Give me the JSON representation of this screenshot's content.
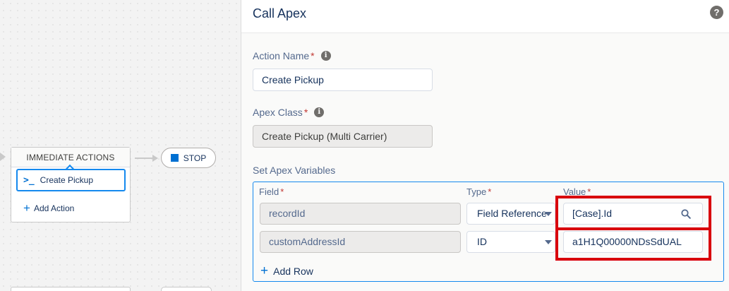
{
  "canvas": {
    "actions_header": "IMMEDIATE ACTIONS",
    "action_item": {
      "icon": ">_",
      "label": "Create Pickup"
    },
    "add_action": "Add Action",
    "stop_label": "STOP"
  },
  "panel": {
    "title": "Call Apex",
    "help_icon": "?",
    "action_name": {
      "label": "Action Name",
      "required": "*",
      "value": "Create Pickup"
    },
    "apex_class": {
      "label": "Apex Class",
      "required": "*",
      "value": "Create Pickup (Multi Carrier)"
    },
    "set_vars": {
      "label": "Set Apex Variables",
      "columns": {
        "field": "Field",
        "type": "Type",
        "value": "Value",
        "required": "*"
      },
      "rows": [
        {
          "field": "recordId",
          "type": "Field Reference",
          "value": "[Case].Id"
        },
        {
          "field": "customAddressId",
          "type": "ID",
          "value": "a1H1Q00000NDsSdUAL"
        }
      ],
      "add_row": "Add Row"
    }
  },
  "colors": {
    "highlight": "#d9000d",
    "accent": "#0070d2",
    "focus": "#1589ee"
  }
}
